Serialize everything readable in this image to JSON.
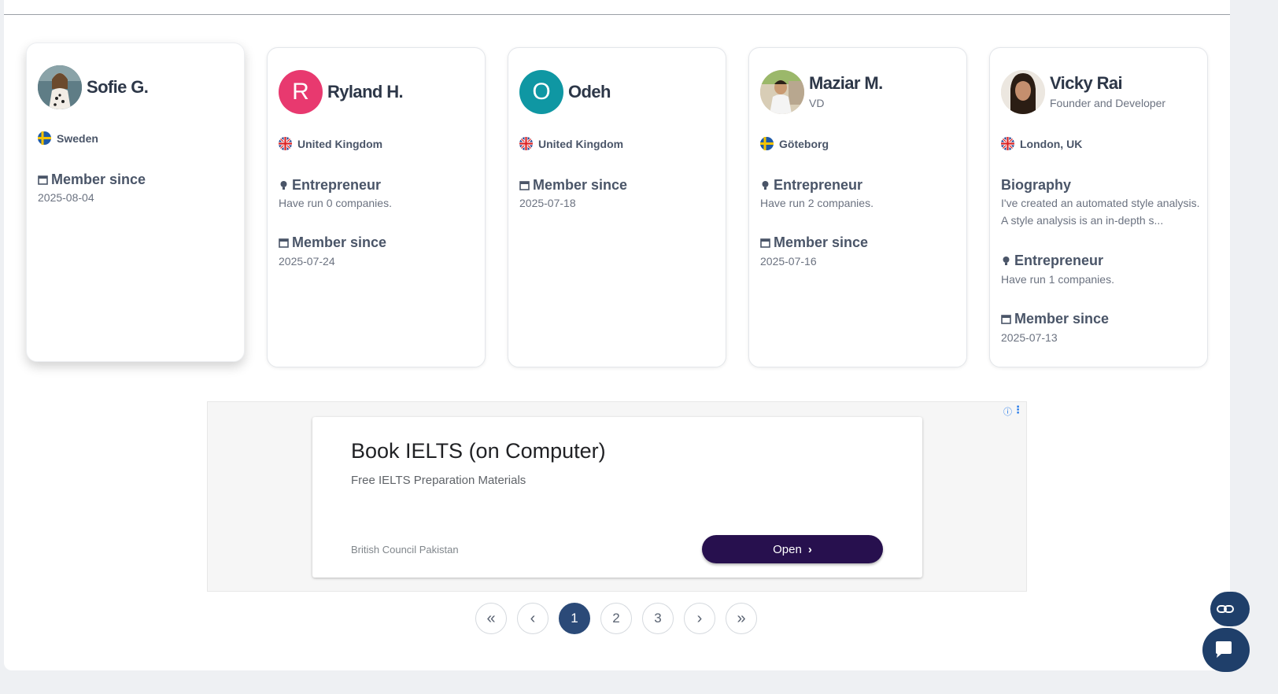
{
  "cards": [
    {
      "name": "Sofie G.",
      "location": "Sweden",
      "member_since_label": "Member since",
      "member_since_date": "2025-08-04"
    },
    {
      "avatar_letter": "R",
      "name": "Ryland H.",
      "location": "United Kingdom",
      "entrepreneur_label": "Entrepreneur",
      "entrepreneur_text": "Have run 0 companies.",
      "member_since_label": "Member since",
      "member_since_date": "2025-07-24"
    },
    {
      "avatar_letter": "O",
      "name": "Odeh",
      "location": "United Kingdom",
      "member_since_label": "Member since",
      "member_since_date": "2025-07-18"
    },
    {
      "name": "Maziar M.",
      "subtitle": "VD",
      "location": "Göteborg",
      "entrepreneur_label": "Entrepreneur",
      "entrepreneur_text": "Have run 2 companies.",
      "member_since_label": "Member since",
      "member_since_date": "2025-07-16"
    },
    {
      "name": "Vicky Rai",
      "subtitle": "Founder and Developer",
      "location": "London, UK",
      "biography_label": "Biography",
      "biography_line1": "I've created an automated style analysis.",
      "biography_line2": "A style analysis is an in-depth s...",
      "entrepreneur_label": "Entrepreneur",
      "entrepreneur_text": "Have run 1 companies.",
      "member_since_label": "Member since",
      "member_since_date": "2025-07-13"
    }
  ],
  "ad": {
    "title": "Book IELTS (on Computer)",
    "description": "Free IELTS Preparation Materials",
    "advertiser": "British Council Pakistan",
    "button_label": "Open",
    "button_chevron": "›"
  },
  "pagination": {
    "first": "«",
    "prev": "‹",
    "pages": [
      "1",
      "2",
      "3"
    ],
    "next": "›",
    "last": "»",
    "active_page": "1"
  },
  "colors": {
    "avatar_r": "#e8396f",
    "avatar_o": "#0f97a3",
    "ad_button": "#27104e",
    "pager_active": "#2b4a78"
  }
}
